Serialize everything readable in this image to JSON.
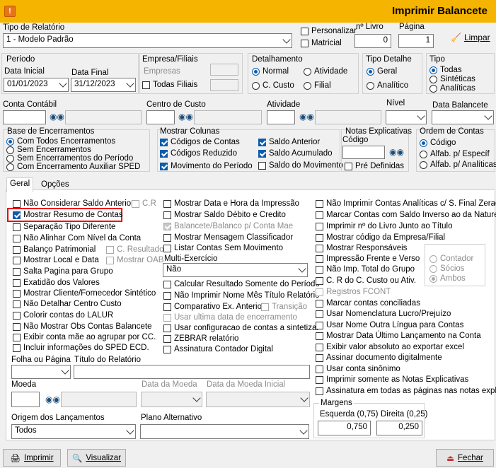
{
  "window": {
    "title": "Imprimir Balancete"
  },
  "header": {
    "tipo_relatorio_label": "Tipo de Relatório",
    "tipo_relatorio_value": "1 - Modelo Padrão",
    "personalizar": "Personalizar",
    "matricial": "Matricial",
    "num_livro_label": "nº Livro",
    "num_livro_value": "0",
    "pagina_label": "Página",
    "pagina_value": "1",
    "limpar": "Limpar"
  },
  "periodo": {
    "label": "Período",
    "data_inicial_label": "Data Inicial",
    "data_inicial": "01/01/2023",
    "data_final_label": "Data Final",
    "data_final": "31/12/2023"
  },
  "empresa": {
    "label": "Empresa/Filiais",
    "empresas": "Empresas",
    "todas_filiais": "Todas Filiais"
  },
  "detalhamento": {
    "label": "Detalhamento",
    "normal": "Normal",
    "atividade": "Atividade",
    "c_custo": "C. Custo",
    "filial": "Filial"
  },
  "tipo_detalhe": {
    "label": "Tipo Detalhe",
    "geral": "Geral",
    "analitico": "Analítico"
  },
  "tipo": {
    "label": "Tipo",
    "todas": "Todas",
    "sinteticas": "Sintéticas",
    "analiticas": "Analíticas"
  },
  "filtros": {
    "conta_contabil": "Conta Contábil",
    "centro_custo": "Centro de Custo",
    "atividade": "Atividade",
    "nivel": "Nível",
    "data_balancete": "Data Balancete"
  },
  "base_enc": {
    "label": "Base de Encerramentos",
    "opt1": "Com Todos Encerramentos",
    "opt2": "Sem Encerramentos",
    "opt3": "Sem Encerramentos do Período",
    "opt4": "Com Encerramento Auxiliar SPED"
  },
  "colunas": {
    "label": "Mostrar Colunas",
    "codigos_contas": "Códigos de Contas",
    "codigos_reduzido": "Códigos Reduzido",
    "movimento_periodo": "Movimento do Período",
    "saldo_anterior": "Saldo Anterior",
    "saldo_acumulado": "Saldo Acumulado",
    "saldo_movimento": "Saldo do Movimento"
  },
  "notas": {
    "label": "Notas Explicativas",
    "codigo": "Código",
    "pre_definidas": "Pré Definidas"
  },
  "ordem": {
    "label": "Ordem de Contas",
    "codigo": "Código",
    "alfab_especif": "Alfab. p/ Específ",
    "alfab_analiticas": "Alfab. p/ Analíticas"
  },
  "tabs": {
    "geral": "Geral",
    "opcoes": "Opções"
  },
  "col1": [
    "Não Considerar Saldo Anterior",
    "Mostrar Resumo de Contas",
    "Separação Tipo Diferente",
    "Não Alinhar Com Nível da Conta",
    "Balanço Patrimonial",
    "Mostrar Local e Data",
    "Salta Pagina para Grupo",
    "Exatidão dos Valores",
    "Mostrar Cliente/Fornecedor Sintético",
    "Não Detalhar Centro Custo",
    "Colorir contas do LALUR",
    "Não Mostrar Obs Contas Balancete",
    "Exibir conta mãe ao agrupar por CC.",
    "Incluir informações do SPED ECD."
  ],
  "col1_extra": {
    "cr": "C.R",
    "c_resultado": "C. Resultado",
    "mostrar_oab": "Mostrar OAB"
  },
  "col2": [
    "Mostrar Data e Hora da Impressão",
    "Mostrar Saldo Débito e Credito",
    "Balancete/Balanco p/ Conta Mae",
    "Mostrar Mensagem Classificador",
    "Listar Contas Sem Movimento"
  ],
  "multi_exercicio": {
    "label": "Multi-Exercício",
    "value": "Não"
  },
  "col2b": [
    "Calcular Resultado Somente do Período",
    "Não Imprimir Nome Mês Título Relatório",
    "Comparativo Ex. Anterior",
    "Usar ultima data de encerramento",
    "Usar configuracao de contas a sintetizar",
    "ZEBRAR relatório",
    "Assinatura Contador Digital"
  ],
  "transicao": "Transição",
  "col3": [
    "Não Imprimir Contas Analíticas c/ S. Final Zerado",
    "Marcar Contas com Saldo Inverso ao da Natureza",
    "Imprimir nº do Livro Junto ao Título",
    "Mostrar código da Empresa/Filial",
    "Mostrar Responsáveis",
    "Impressão Frente e Verso",
    "Não Imp. Total do Grupo",
    "C. R do C. Custo ou Ativ.",
    "Registros FCONT",
    "Marcar contas conciliadas",
    "Usar Nomenclatura Lucro/Prejuízo",
    "Usar Nome Outra Língua para Contas",
    "Mostrar Data Último Lançamento na Conta",
    "Exibir valor absoluto ao exportar excel",
    "Assinar documento digitalmente",
    "Usar conta sinônimo",
    "Imprimir somente as Notas Explicativas",
    "Assinatura em todas as páginas nas notas explic."
  ],
  "resp_opts": {
    "contador": "Contador",
    "socios": "Sócios",
    "ambos": "Ambos"
  },
  "bottom": {
    "folha_pagina": "Folha ou Página",
    "titulo_relatorio": "Título do Relatório",
    "moeda": "Moeda",
    "data_moeda": "Data da Moeda",
    "data_moeda_inicial": "Data da Moeda Inicial",
    "origem_label": "Origem dos Lançamentos",
    "origem_value": "Todos",
    "plano_alternativo": "Plano Alternativo"
  },
  "margens": {
    "label": "Margens",
    "esquerda_label": "Esquerda (0,75)",
    "esquerda_value": "0,750",
    "direita_label": "Direita (0,25)",
    "direita_value": "0,250"
  },
  "buttons": {
    "imprimir": "Imprimir",
    "visualizar": "Visualizar",
    "fechar": "Fechar"
  }
}
